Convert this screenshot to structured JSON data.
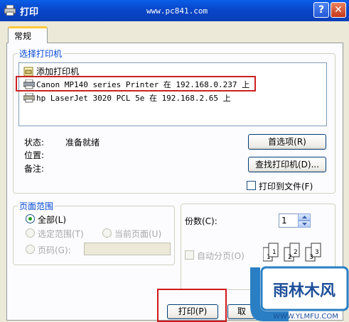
{
  "window": {
    "title": "打印",
    "watermark_url": "www.pc841.com",
    "help_glyph": "?",
    "close_glyph": "✕"
  },
  "tab": {
    "label": "常规"
  },
  "select_printer": {
    "legend": "选择打印机",
    "printers": [
      {
        "label": "添加打印机",
        "icon": "add-printer-icon"
      },
      {
        "label": "Canon MP140 series Printer 在 192.168.0.237 上",
        "icon": "printer-icon"
      },
      {
        "label": "hp LaserJet 3020 PCL 5e 在 192.168.2.65 上",
        "icon": "printer-icon"
      }
    ],
    "status_label": "状态:",
    "status_value": "准备就绪",
    "location_label": "位置:",
    "comment_label": "备注:",
    "preferences_button": "首选项(R)",
    "find_printer_button": "查找打印机(D)...",
    "print_to_file_label": "打印到文件(F)"
  },
  "page_range": {
    "legend": "页面范围",
    "all_label": "全部(L)",
    "selection_label": "选定范围(T)",
    "current_page_label": "当前页面(U)",
    "pages_label": "页码(G):",
    "pages_value": ""
  },
  "copies": {
    "label": "份数(C):",
    "value": "1",
    "collate_label": "自动分页(O)",
    "collate_pages": [
      "1",
      "1",
      "2",
      "2",
      "3",
      "3"
    ]
  },
  "buttons": {
    "print": "打印(P)",
    "cancel": "取"
  },
  "watermark_logo": {
    "brand": "雨林木风",
    "url": "WWW.YLMFU.COM"
  },
  "colors": {
    "accent_blue": "#0046d5",
    "highlight_red": "#cc2020"
  }
}
